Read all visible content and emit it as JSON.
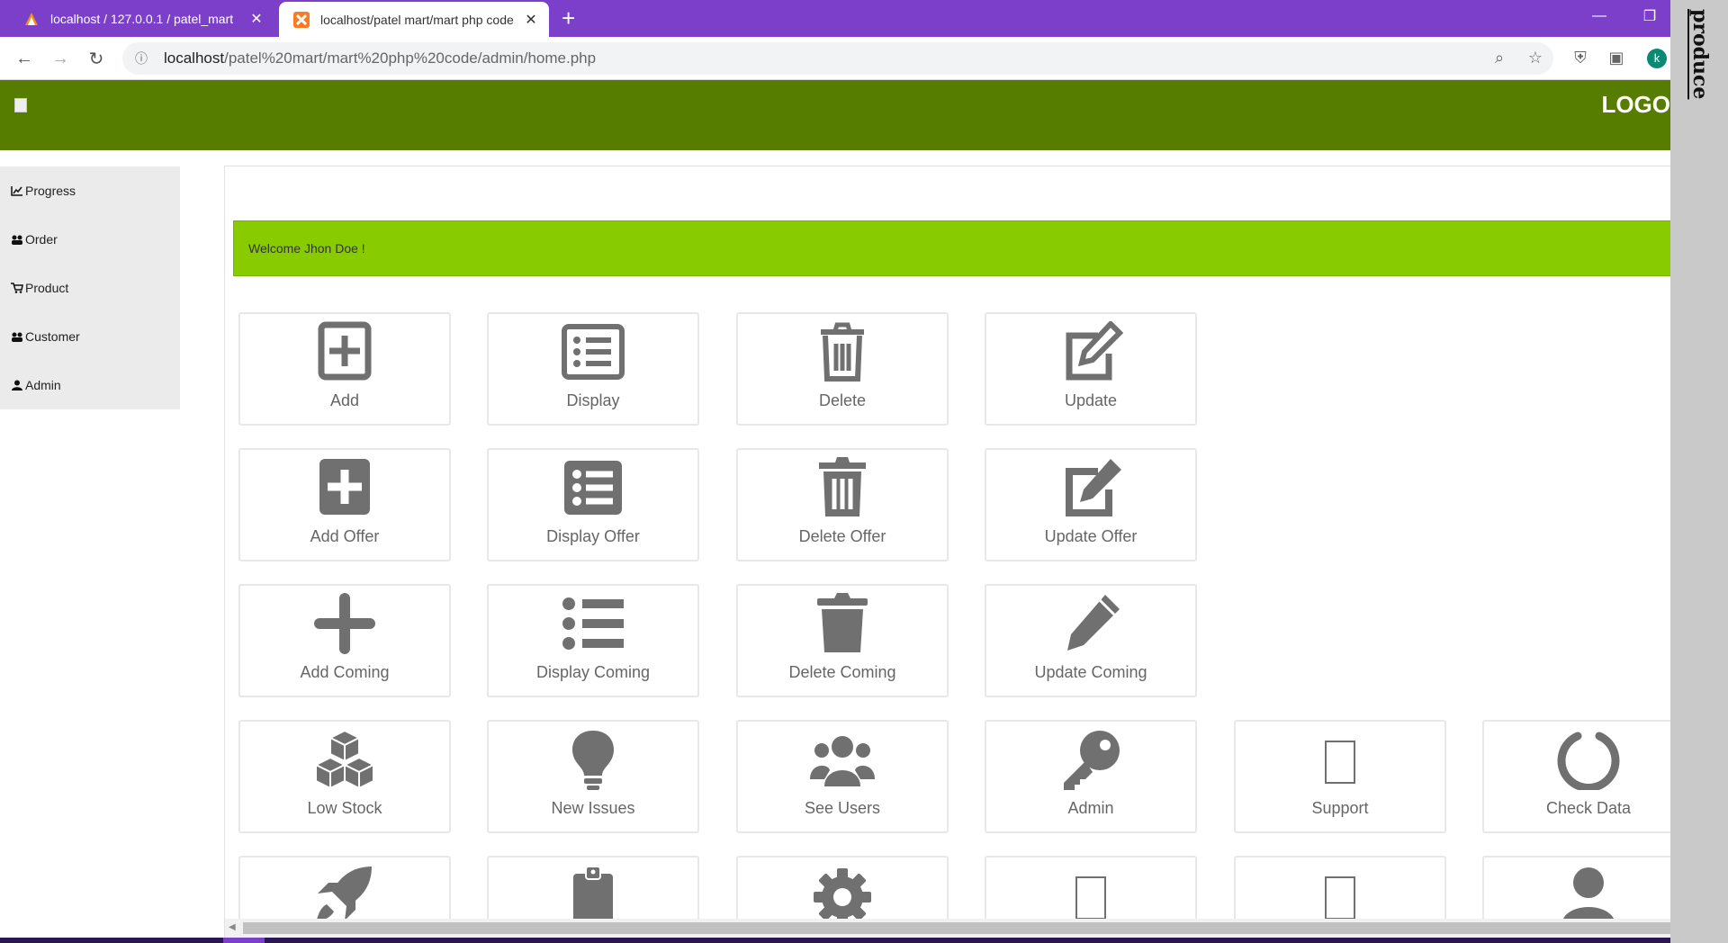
{
  "browser": {
    "tabs": [
      {
        "title": "localhost / 127.0.0.1 / patel_mart",
        "active": false
      },
      {
        "title": "localhost/patel mart/mart php code",
        "active": true
      }
    ],
    "new_tab": "+",
    "address": {
      "host": "localhost",
      "path": "/patel%20mart/mart%20php%20code/admin/home.php"
    },
    "profile_initial": "k",
    "colors": {
      "tabbar": "#7b3fc9"
    }
  },
  "header": {
    "logo_text": "LOGO",
    "color": "#567d00"
  },
  "sidebar": {
    "items": [
      {
        "label": "Progress",
        "icon": "chart-line-icon"
      },
      {
        "label": "Order",
        "icon": "users-icon"
      },
      {
        "label": "Product",
        "icon": "cart-icon"
      },
      {
        "label": "Customer",
        "icon": "users-icon"
      },
      {
        "label": "Admin",
        "icon": "user-icon"
      }
    ]
  },
  "welcome": {
    "text": "Welcome Jhon Doe !",
    "color": "#88cc00"
  },
  "cards": [
    {
      "label": "Add",
      "icon": "plus-square-outline-icon"
    },
    {
      "label": "Display",
      "icon": "list-alt-outline-icon"
    },
    {
      "label": "Delete",
      "icon": "trash-outline-icon"
    },
    {
      "label": "Update",
      "icon": "edit-outline-icon"
    },
    {
      "label": "Add Offer",
      "icon": "plus-square-icon"
    },
    {
      "label": "Display Offer",
      "icon": "list-alt-icon"
    },
    {
      "label": "Delete Offer",
      "icon": "trash-alt-icon"
    },
    {
      "label": "Update Offer",
      "icon": "edit-icon"
    },
    {
      "label": "Add Coming",
      "icon": "plus-icon"
    },
    {
      "label": "Display Coming",
      "icon": "list-ul-icon"
    },
    {
      "label": "Delete Coming",
      "icon": "trash-icon"
    },
    {
      "label": "Update Coming",
      "icon": "pencil-icon"
    },
    {
      "label": "Low Stock",
      "icon": "cubes-icon"
    },
    {
      "label": "New Issues",
      "icon": "lightbulb-icon"
    },
    {
      "label": "See Users",
      "icon": "users-icon"
    },
    {
      "label": "Admin",
      "icon": "key-icon"
    },
    {
      "label": "Support",
      "icon": "missing-glyph-icon"
    },
    {
      "label": "Check Data",
      "icon": "circle-notch-icon"
    },
    {
      "label": "",
      "icon": "rocket-icon"
    },
    {
      "label": "",
      "icon": "clipboard-icon"
    },
    {
      "label": "",
      "icon": "cog-icon"
    },
    {
      "label": "",
      "icon": "missing-glyph-icon"
    },
    {
      "label": "",
      "icon": "missing-glyph-icon"
    },
    {
      "label": "",
      "icon": "user-icon"
    }
  ],
  "side_panel": {
    "text": "produce"
  }
}
